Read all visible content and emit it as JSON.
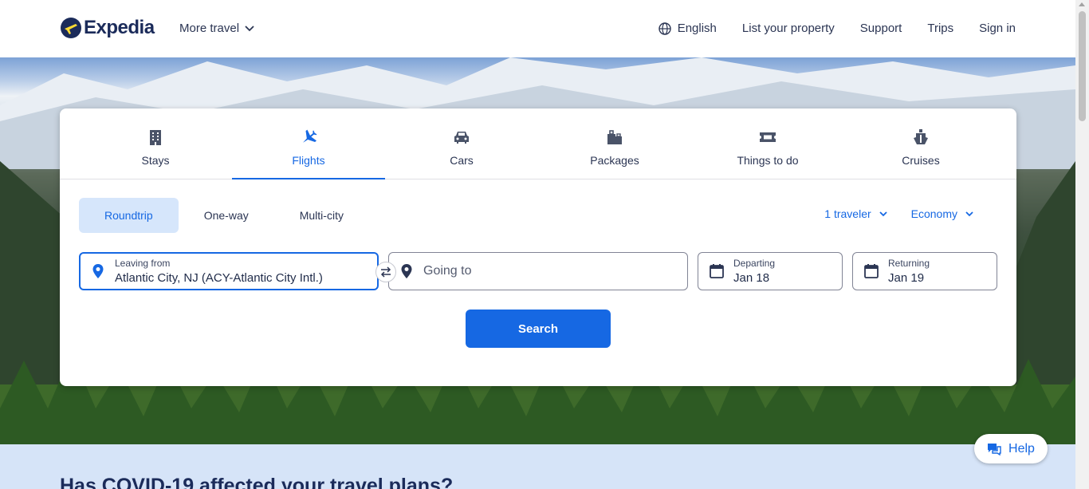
{
  "header": {
    "logo_text": "Expedia",
    "more_travel": "More travel",
    "language": "English",
    "list_property": "List your property",
    "support": "Support",
    "trips": "Trips",
    "sign_in": "Sign in"
  },
  "tabs": [
    {
      "label": "Stays",
      "icon": "building-icon"
    },
    {
      "label": "Flights",
      "icon": "plane-icon",
      "active": true
    },
    {
      "label": "Cars",
      "icon": "car-icon"
    },
    {
      "label": "Packages",
      "icon": "luggage-icon"
    },
    {
      "label": "Things to do",
      "icon": "ticket-icon"
    },
    {
      "label": "Cruises",
      "icon": "ship-icon"
    }
  ],
  "trip_types": [
    {
      "label": "Roundtrip",
      "active": true
    },
    {
      "label": "One-way"
    },
    {
      "label": "Multi-city"
    }
  ],
  "travelers": "1 traveler",
  "cabin": "Economy",
  "fields": {
    "leaving_label": "Leaving from",
    "leaving_value": "Atlantic City, NJ (ACY-Atlantic City Intl.)",
    "going_placeholder": "Going to",
    "departing_label": "Departing",
    "departing_value": "Jan 18",
    "returning_label": "Returning",
    "returning_value": "Jan 19"
  },
  "search_label": "Search",
  "covid_heading": "Has COVID-19 affected your travel plans?",
  "help_label": "Help",
  "colors": {
    "accent": "#1668e3",
    "accent_light": "#d6e6fb",
    "text_dark": "#1f2b49",
    "banner_bg": "#d6e4f8"
  }
}
